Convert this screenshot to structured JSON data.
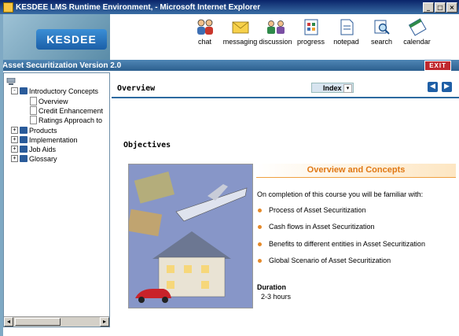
{
  "window": {
    "title": "KESDEE LMS Runtime Environment, - Microsoft Internet Explorer",
    "buttons": [
      "_",
      "□",
      "×"
    ]
  },
  "toolbar": {
    "logo_text": "KESDEE",
    "tools": [
      {
        "label": "chat",
        "icon": "chat-icon"
      },
      {
        "label": "messaging",
        "icon": "envelope-icon"
      },
      {
        "label": "discussion",
        "icon": "discussion-icon"
      },
      {
        "label": "progress",
        "icon": "progress-icon"
      },
      {
        "label": "notepad",
        "icon": "notepad-icon"
      },
      {
        "label": "search",
        "icon": "search-icon"
      },
      {
        "label": "calendar",
        "icon": "calendar-icon"
      }
    ]
  },
  "coursebar": {
    "title": "Asset Securitization Version 2.0",
    "exit_label": "EXIT"
  },
  "tree": {
    "items": [
      {
        "label": "Introductory Concepts",
        "level": 0,
        "expand": "-",
        "type": "book"
      },
      {
        "label": "Overview",
        "level": 1,
        "type": "page"
      },
      {
        "label": "Credit Enhancement",
        "level": 1,
        "type": "page"
      },
      {
        "label": "Ratings Approach to",
        "level": 1,
        "type": "page"
      },
      {
        "label": "Products",
        "level": 0,
        "expand": "+",
        "type": "book"
      },
      {
        "label": "Implementation",
        "level": 0,
        "expand": "+",
        "type": "book"
      },
      {
        "label": "Job Aids",
        "level": 0,
        "expand": "+",
        "type": "book"
      },
      {
        "label": "Glossary",
        "level": 0,
        "expand": "+",
        "type": "book"
      }
    ]
  },
  "content": {
    "section_title": "Overview",
    "index_label": "Index",
    "objectives_label": "Objectives",
    "concepts_title": "Overview and Concepts",
    "intro_text": "On completion of this course you will be familiar with:",
    "bullets": [
      "Process of Asset Securitization",
      "Cash flows in  Asset Securitization",
      "Benefits to different entities in Asset Securitization",
      "Global Scenario of Asset Securitization"
    ],
    "duration_label": "Duration",
    "duration_value": "2-3 hours"
  },
  "colors": {
    "accent": "#2d6aa0",
    "concept_title": "#e07814",
    "exit": "#c0282e"
  }
}
